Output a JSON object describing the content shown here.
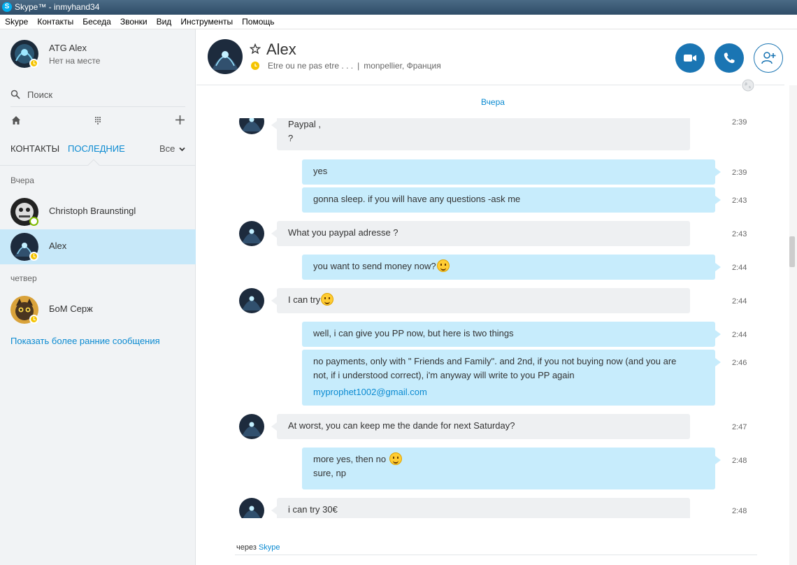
{
  "window": {
    "title": "Skype™ - inmyhand34",
    "logo_letter": "S"
  },
  "menu": [
    "Skype",
    "Контакты",
    "Беседа",
    "Звонки",
    "Вид",
    "Инструменты",
    "Помощь"
  ],
  "profile": {
    "name": "ATG Alex",
    "status": "Нет на месте"
  },
  "search": {
    "label": "Поиск"
  },
  "tabs": {
    "contacts": "КОНТАКТЫ",
    "recent": "ПОСЛЕДНИЕ",
    "filter": "Все"
  },
  "recent_groups": [
    {
      "label": "Вчера",
      "contacts": [
        {
          "name": "Christoph Braunstingl",
          "status": "online"
        },
        {
          "name": "Alex",
          "status": "away",
          "active": true
        }
      ]
    },
    {
      "label": "четвер",
      "contacts": [
        {
          "name": "БоМ Серж",
          "status": "away"
        }
      ]
    }
  ],
  "show_earlier": "Показать более ранние сообщения",
  "conversation": {
    "name": "Alex",
    "mood": "Etre ou ne pas etre . . .",
    "separator": "|",
    "location": "monpellier, Франция",
    "day_label": "Вчера",
    "via_prefix": "через",
    "via_link": "Skype"
  },
  "messages": [
    {
      "dir": "in",
      "lines": [
        "Paypal ,",
        "?"
      ],
      "time": "2:39"
    },
    {
      "dir": "out",
      "lines": [
        "yes"
      ],
      "time": "2:39"
    },
    {
      "dir": "out",
      "lines": [
        "gonna sleep. if you will have any questions  -ask me"
      ],
      "time": "2:43"
    },
    {
      "dir": "in",
      "lines": [
        "What you paypal adresse ?"
      ],
      "time": "2:43"
    },
    {
      "dir": "out",
      "lines": [
        "you want to send money now?"
      ],
      "emoji": "smile-emoji",
      "time": "2:44"
    },
    {
      "dir": "in",
      "lines": [
        "I can try"
      ],
      "emoji": "wink-emoji",
      "time": "2:44"
    },
    {
      "dir": "out",
      "lines": [
        "well, i can give you PP now, but here is two things"
      ],
      "time": "2:44"
    },
    {
      "dir": "out",
      "lines": [
        "no payments, only with \" Friends and Family\". and 2nd, if you not buying now (and you are",
        "not, if i understood correct), i'm anyway will write to you PP again"
      ],
      "link": "myprophet1002@gmail.com",
      "time": "2:46"
    },
    {
      "dir": "in",
      "lines": [
        "At worst, you can keep me the dande for next Saturday?"
      ],
      "time": "2:47"
    },
    {
      "dir": "out",
      "lines": [
        "more yes, then no",
        "sure, np"
      ],
      "emoji": "tongue-emoji",
      "time": "2:48"
    },
    {
      "dir": "in",
      "lines": [
        "i can try 30€"
      ],
      "time": "2:48"
    }
  ],
  "colors": {
    "accent": "#1a75b3",
    "link": "#0a8ad1",
    "away": "#f5c400",
    "online": "#7fba00",
    "out_bubble": "#c7ecfc",
    "in_bubble": "#eef0f2",
    "active_contact": "#c7e8f9"
  },
  "icons": [
    "search-icon",
    "home-icon",
    "dialpad-icon",
    "plus-icon",
    "chevron-down-icon",
    "star-icon",
    "away-clock-icon",
    "video-call-icon",
    "phone-icon",
    "add-contact-icon",
    "globe-icon"
  ]
}
